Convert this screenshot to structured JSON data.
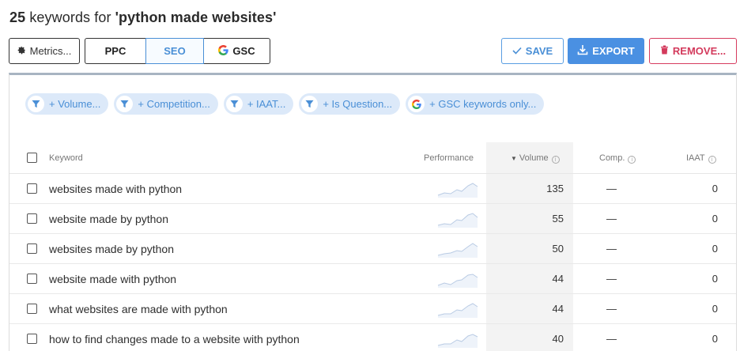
{
  "header": {
    "count": "25",
    "prefix": " keywords for ",
    "query": "'python made websites'"
  },
  "toolbar": {
    "metrics_label": "Metrics...",
    "ppc_label": "PPC",
    "seo_label": "SEO",
    "gsc_label": "GSC",
    "save_label": "SAVE",
    "export_label": "EXPORT",
    "remove_label": "REMOVE..."
  },
  "filters": [
    {
      "label": "+ Volume...",
      "icon": "filter-icon"
    },
    {
      "label": "+ Competition...",
      "icon": "filter-icon"
    },
    {
      "label": "+ IAAT...",
      "icon": "filter-icon"
    },
    {
      "label": "+ Is Question...",
      "icon": "filter-icon"
    },
    {
      "label": "+ GSC keywords only...",
      "icon": "google-icon"
    }
  ],
  "table": {
    "columns": {
      "keyword": "Keyword",
      "performance": "Performance",
      "volume": "Volume",
      "comp": "Comp.",
      "iaat": "IAAT"
    },
    "sort_column": "volume",
    "rows": [
      {
        "keyword": "websites made with python",
        "volume": "135",
        "comp": "—",
        "iaat": "0"
      },
      {
        "keyword": "website made by python",
        "volume": "55",
        "comp": "—",
        "iaat": "0"
      },
      {
        "keyword": "websites made by python",
        "volume": "50",
        "comp": "—",
        "iaat": "0"
      },
      {
        "keyword": "website made with python",
        "volume": "44",
        "comp": "—",
        "iaat": "0"
      },
      {
        "keyword": "what websites are made with python",
        "volume": "44",
        "comp": "—",
        "iaat": "0"
      },
      {
        "keyword": "how to find changes made to a website with python",
        "volume": "40",
        "comp": "—",
        "iaat": "0"
      }
    ]
  },
  "colors": {
    "accent": "#4a90e2",
    "danger": "#d33a5c",
    "chip_bg": "#dce9f9"
  }
}
